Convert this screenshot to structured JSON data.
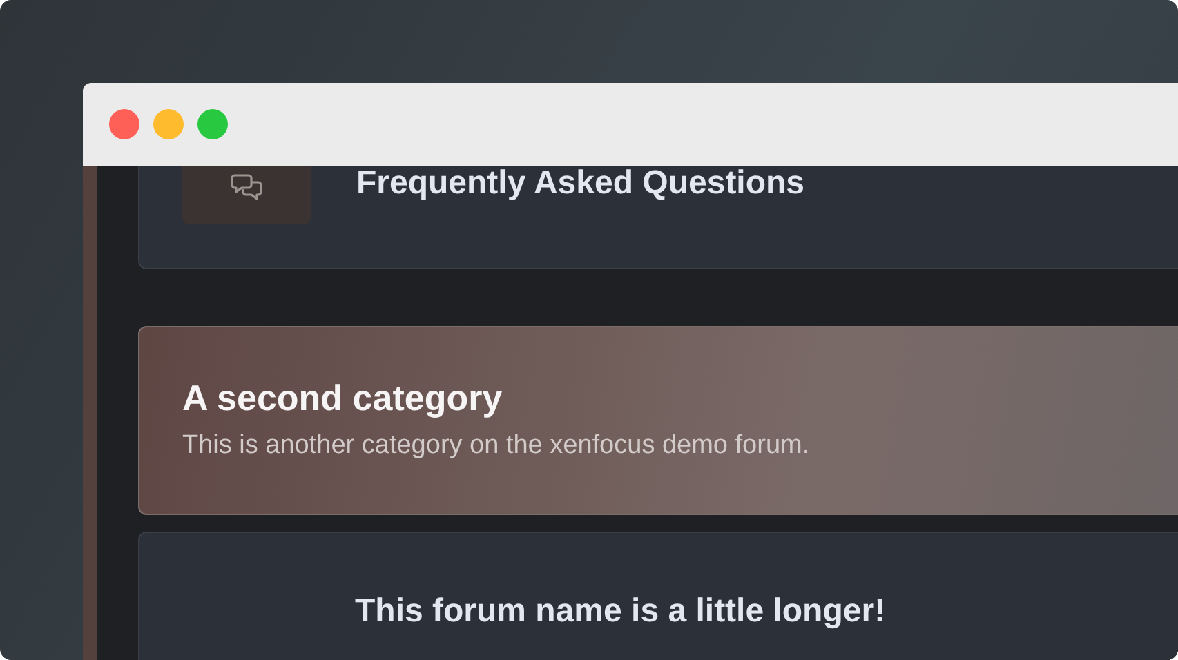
{
  "window": {
    "controls": [
      {
        "color": "#fe5f57"
      },
      {
        "color": "#febb2e"
      },
      {
        "color": "#28c840"
      }
    ]
  },
  "nodes": [
    {
      "kind": "forum",
      "title": "Frequently Asked Questions",
      "icon": true
    },
    {
      "kind": "category",
      "title": "A second category",
      "description": "This is another category on the xenfocus demo forum."
    },
    {
      "kind": "forum",
      "title": "This forum name is a little longer!",
      "icon": false
    }
  ]
}
